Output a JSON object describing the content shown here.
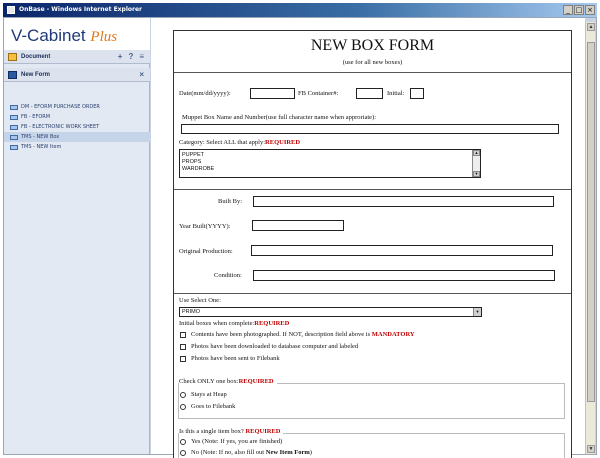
{
  "window": {
    "title": "OnBase - Windows Internet Explorer",
    "buttons": [
      "_",
      "□",
      "×"
    ]
  },
  "sidebar": {
    "logo_main": "V-Cabinet",
    "logo_plus": "Plus",
    "document_label": "Document",
    "document_tools": [
      "+",
      "?",
      "≡"
    ],
    "newform_label": "New Form",
    "newform_tool": "×",
    "forms": [
      "DM - EFORM PURCHASE ORDER",
      "FB - EFORM",
      "FB - ELECTRONIC WORK SHEET",
      "TMS - NEW Box",
      "TMS - NEW Item"
    ]
  },
  "form": {
    "title": "NEW BOX FORM",
    "subtitle": "(use for all new boxes)",
    "date_label": "Date(mm/dd/yyyy):",
    "fb_container_label": "FB Container#:",
    "initial_label": "Initial:",
    "muppet_label": "Muppet Box Name and Number(use full character name when approriate):",
    "category_label": "Category: Select ALL that apply:",
    "category_req": "REQUIRED",
    "category_options": [
      "PUPPET",
      "PROPS",
      "WARDROBE"
    ],
    "built_by_label": "Built By:",
    "year_built_label": "Year Built(YYYY):",
    "original_production_label": "Original Production:",
    "condition_label": "Condition:",
    "use_select_label": "Use Select One:",
    "use_select_value": "PRIMO",
    "initial_boxes_label": "Initial boxes when complete:",
    "initial_boxes_req": "REQUIRED",
    "initial_boxes_options": [
      {
        "text": "Contents have been photographed. If NOT, description field above is ",
        "mandatory": "MANDATORY"
      },
      {
        "text": "Photos have been downloaded to database computer and labeled",
        "mandatory": ""
      },
      {
        "text": "Photos have been sent to Filebank",
        "mandatory": ""
      }
    ],
    "check_one_label": "Check ONLY one box:",
    "check_one_req": "REQUIRED",
    "check_one_options": [
      "Stays at Heap",
      "Goes to Filebank"
    ],
    "single_item_label": "Is this a single item box?",
    "single_item_req": "REQUIRED",
    "single_yes": "Yes   (Note: If yes, you are finished)",
    "single_no": "No   (Note: If no, also fill out ",
    "single_no_bold": "New Item Form",
    "single_no_end": ")"
  }
}
